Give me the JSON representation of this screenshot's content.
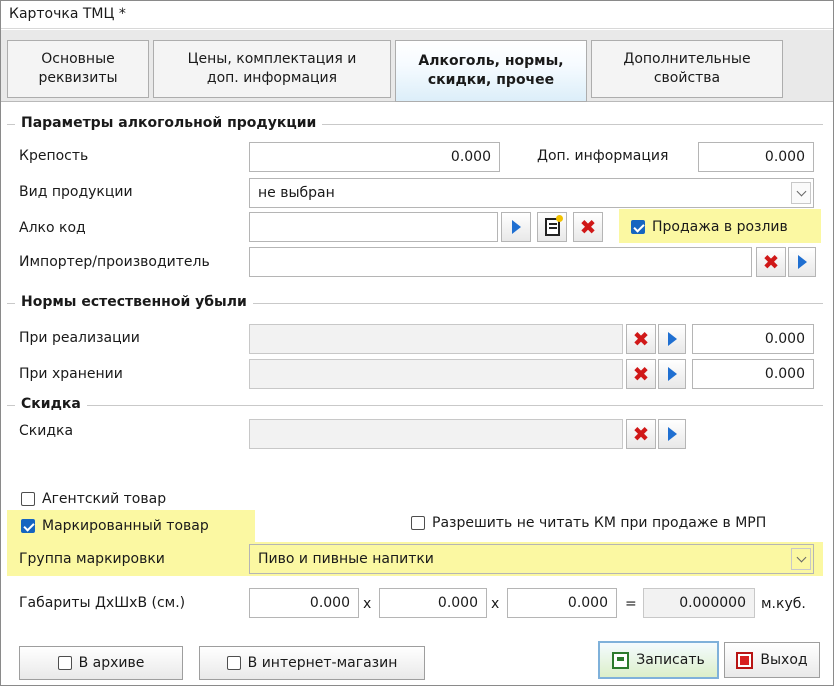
{
  "window": {
    "title": "Карточка ТМЦ *"
  },
  "tabs": [
    {
      "label": "Основные\nреквизиты",
      "active": false
    },
    {
      "label": "Цены, комплектация и\nдоп.  информация",
      "active": false
    },
    {
      "label": "Алкоголь, нормы,\nскидки, прочее",
      "active": true
    },
    {
      "label": "Дополнительные\nсвойства",
      "active": false
    }
  ],
  "alcohol": {
    "section_title": "Параметры алкогольной продукции",
    "strength_label": "Крепость",
    "strength_value": "0.000",
    "extra_info_label": "Доп. информация",
    "extra_info_value": "0.000",
    "product_type_label": "Вид продукции",
    "product_type_value": "не выбран",
    "alco_code_label": "Алко код",
    "alco_code_value": "",
    "draft_sale_label": "Продажа в розлив",
    "draft_sale_checked": true,
    "importer_label": "Импортер/производитель",
    "importer_value": ""
  },
  "loss_norms": {
    "section_title": "Нормы естественной убыли",
    "sale_label": "При реализации",
    "sale_value": "0.000",
    "storage_label": "При хранении",
    "storage_value": "0.000"
  },
  "discount": {
    "section_title": "Скидка",
    "discount_label": "Скидка",
    "discount_value": ""
  },
  "flags": {
    "agent_label": "Агентский товар",
    "agent_checked": false,
    "marked_label": "Маркированный товар",
    "marked_checked": true,
    "allow_no_km_label": "Разрешить не читать КМ при продаже в МРП",
    "allow_no_km_checked": false
  },
  "marking": {
    "group_label": "Группа маркировки",
    "group_value": "Пиво и пивные напитки"
  },
  "dimensions": {
    "label": "Габариты ДхШхВ (см.)",
    "length": "0.000",
    "width": "0.000",
    "height": "0.000",
    "times_sign": "x",
    "equals_sign": "=",
    "volume": "0.000000",
    "unit": "м.куб."
  },
  "footer": {
    "archive_label": "В архиве",
    "archive_checked": false,
    "online_shop_label": "В интернет-магазин",
    "online_shop_checked": false,
    "save_label": "Записать",
    "exit_label": "Выход"
  },
  "colors": {
    "highlight": "#fbf8a2",
    "checkbox_checked": "#1565c0",
    "clear_icon": "#d01818",
    "select_icon": "#1f6fd1"
  }
}
